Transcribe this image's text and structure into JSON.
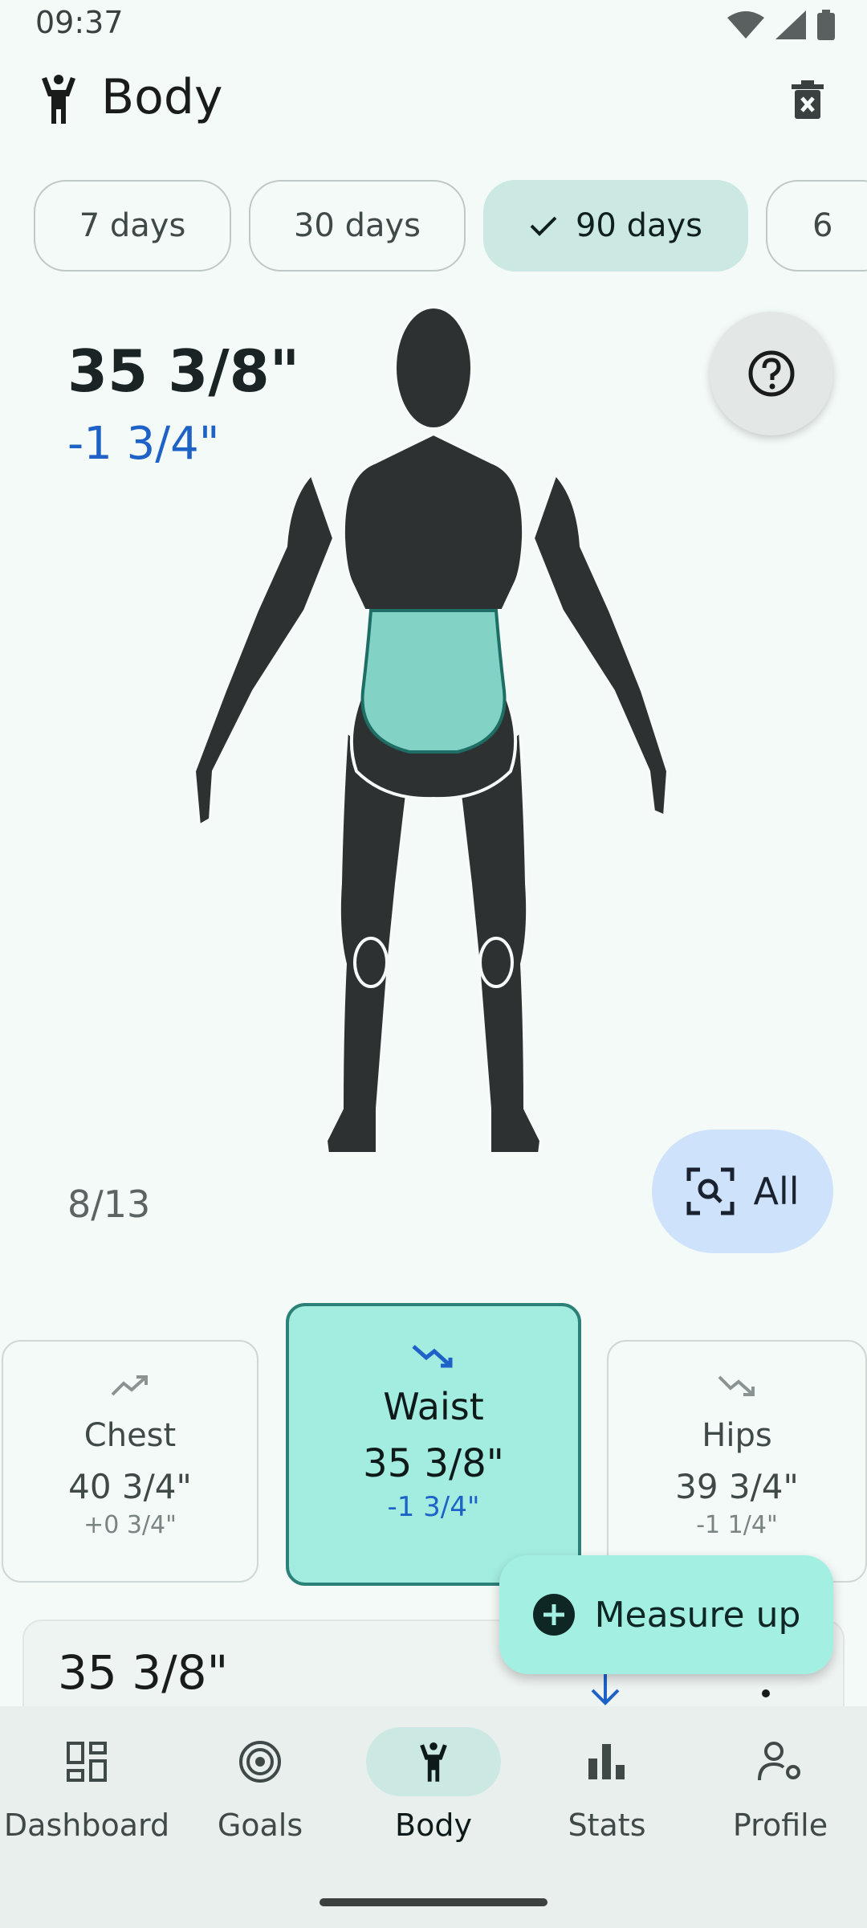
{
  "status_bar": {
    "time": "09:37"
  },
  "app_bar": {
    "title": "Body",
    "delete_icon": "delete-icon"
  },
  "range_chips": [
    {
      "label": "7 days",
      "selected": false
    },
    {
      "label": "30 days",
      "selected": false
    },
    {
      "label": "90 days",
      "selected": true
    },
    {
      "label": "6",
      "selected": false
    }
  ],
  "selected_measurement": {
    "value": "35 3/8\"",
    "delta": "-1 3/4\""
  },
  "counter": "8/13",
  "all_button": {
    "label": "All"
  },
  "cards": [
    {
      "name": "Chest",
      "value": "40 3/4\"",
      "delta": "+0 3/4\"",
      "trend": "trending-up-icon"
    },
    {
      "name": "Waist",
      "value": "35 3/8\"",
      "delta": "-1 3/4\"",
      "trend": "trending-down-icon"
    },
    {
      "name": "Hips",
      "value": "39 3/4\"",
      "delta": "-1 1/4\"",
      "trend": "trending-down-icon"
    }
  ],
  "entry": {
    "value": "35 3/8\""
  },
  "fab": {
    "label": "Measure up"
  },
  "bottom_nav": [
    {
      "label": "Dashboard",
      "icon": "dashboard-icon"
    },
    {
      "label": "Goals",
      "icon": "target-icon"
    },
    {
      "label": "Body",
      "icon": "body-icon",
      "active": true
    },
    {
      "label": "Stats",
      "icon": "bar-chart-icon"
    },
    {
      "label": "Profile",
      "icon": "profile-settings-icon"
    }
  ],
  "colors": {
    "background": "#f3faf8",
    "accent": "#a3ece0",
    "negative_delta": "#1e62c8",
    "figure": "#2d3131"
  }
}
